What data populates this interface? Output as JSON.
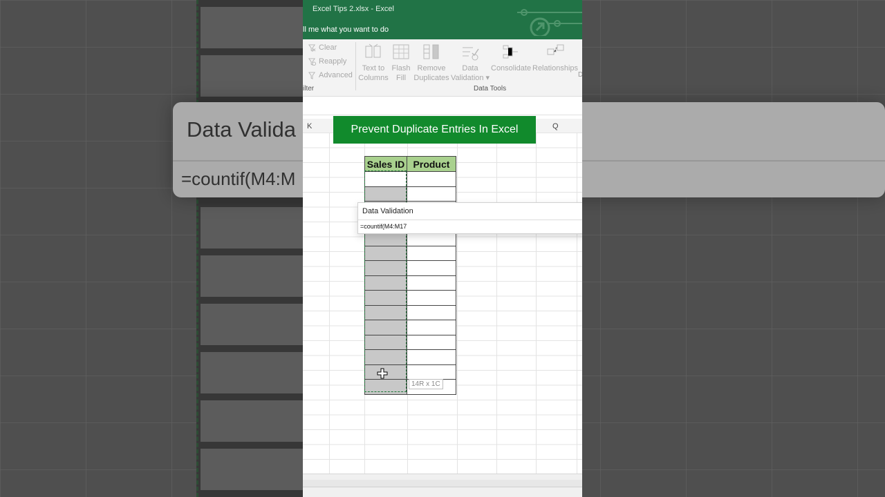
{
  "window": {
    "title": "Excel Tips 2.xlsx  -  Excel",
    "tell_me": "ll me what you want to do"
  },
  "ribbon": {
    "filter_group": {
      "clear": "Clear",
      "reapply": "Reapply",
      "advanced": "Advanced",
      "label": "ilter"
    },
    "data_tools": {
      "text_to_columns": "Text to\nColumns",
      "flash_fill": "Flash\nFill",
      "remove_duplicates": "Remove\nDuplicates",
      "data_validation": "Data\nValidation ▾",
      "consolidate": "Consolidate",
      "relationships": "Relationships",
      "label": "Data Tools",
      "edge": "D"
    }
  },
  "columns": {
    "k": "K",
    "q": "Q"
  },
  "banner": "Prevent Duplicate Entries In Excel",
  "table": {
    "headers": [
      "Sales ID",
      "Product"
    ],
    "row_count": 15
  },
  "popup": {
    "title": "Data Validation",
    "formula": "=countif(M4:M17"
  },
  "size_tip": "14R x 1C",
  "background": {
    "card_title": "Data Valida",
    "card_formula": "=countif(M4:M"
  },
  "colors": {
    "excel_green": "#217346",
    "banner_green": "#118a2c",
    "header_fill": "#a9d18e"
  }
}
